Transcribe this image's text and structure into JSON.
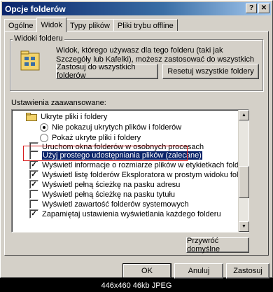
{
  "window": {
    "title": "Opcje folderów",
    "help_btn": "?",
    "close_btn": "✕"
  },
  "tabs": [
    {
      "label": "Ogólne",
      "active": false
    },
    {
      "label": "Widok",
      "active": true
    },
    {
      "label": "Typy plików",
      "active": false
    },
    {
      "label": "Pliki trybu offline",
      "active": false
    }
  ],
  "folder_views": {
    "legend": "Widoki folderu",
    "description": "Widok, którego używasz dla tego folderu (taki jak Szczegóły lub Kafelki), możesz zastosować do wszystkich folderów.",
    "apply_all_label": "Zastosuj do wszystkich folderów",
    "reset_all_label": "Resetuj wszystkie foldery"
  },
  "advanced": {
    "label": "Ustawienia zaawansowane:",
    "items": [
      {
        "type": "folder",
        "label": "Ukryte pliki i foldery"
      },
      {
        "type": "radio",
        "checked": true,
        "label": "Nie pokazuj ukrytych plików i folderów"
      },
      {
        "type": "radio",
        "checked": false,
        "label": "Pokaż ukryte pliki i foldery"
      },
      {
        "type": "checkbox",
        "checked": false,
        "label": "Uruchom okna folderów w osobnych procesach"
      },
      {
        "type": "checkbox",
        "checked": false,
        "selected": true,
        "label": "Użyj prostego udostępniania plików (zalecane)"
      },
      {
        "type": "checkbox",
        "checked": true,
        "label": "Wyświetl informacje o rozmiarze plików w etykietkach folderów"
      },
      {
        "type": "checkbox",
        "checked": true,
        "label": "Wyświetl listę folderów Eksploratora w prostym widoku folderów"
      },
      {
        "type": "checkbox",
        "checked": true,
        "label": "Wyświetl pełną ścieżkę na pasku adresu"
      },
      {
        "type": "checkbox",
        "checked": false,
        "label": "Wyświetl pełną ścieżkę na pasku tytułu"
      },
      {
        "type": "checkbox",
        "checked": false,
        "label": "Wyświetl zawartość folderów systemowych"
      },
      {
        "type": "checkbox",
        "checked": true,
        "label": "Zapamiętaj ustawienia wyświetlania każdego folderu"
      }
    ]
  },
  "restore_defaults_label": "Przywróć domyślne",
  "dialog_buttons": {
    "ok": "OK",
    "cancel": "Anuluj",
    "apply": "Zastosuj"
  },
  "footer": "446x460 46kb JPEG",
  "colors": {
    "titlebar_start": "#0a246a",
    "highlight_box": "#d81e1e",
    "selection": "#0a246a"
  }
}
